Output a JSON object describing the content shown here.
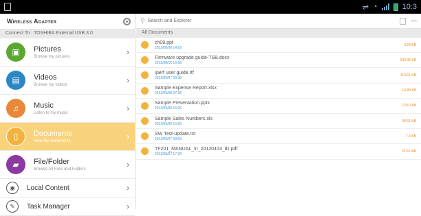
{
  "status": {
    "time": "10:3"
  },
  "sidebar": {
    "title": "Wireless Adapter",
    "connect": "Connect To : TOSHIBA External USB 3.0",
    "items": [
      {
        "label": "Pictures",
        "sub": "Browse my pictures",
        "color": "#5aa832"
      },
      {
        "label": "Videos",
        "sub": "Browse my videos",
        "color": "#2b86c5"
      },
      {
        "label": "Music",
        "sub": "Listen to my music",
        "color": "#e8893a"
      },
      {
        "label": "Documents",
        "sub": "View my documents",
        "color": "#f2b33d"
      },
      {
        "label": "File/Folder",
        "sub": "Browse All Files and Folders",
        "color": "#8a3aa0"
      }
    ],
    "small_items": [
      {
        "label": "Local Content"
      },
      {
        "label": "Task Manager"
      }
    ],
    "chevron": "›"
  },
  "search": {
    "placeholder": "Search and Explorer"
  },
  "section_title": "All Documents",
  "files": [
    {
      "name": "ch08.ppt",
      "date": "2012/08/06 14:16",
      "size": "3.24 KB"
    },
    {
      "name": "Firmware upgrade guide-TSB.docx",
      "date": "2012/08/16 16:58",
      "size": "239.95 KB"
    },
    {
      "name": "Iperf user guide.rtf",
      "date": "2012/09/07 09:38",
      "size": "113.61 KB"
    },
    {
      "name": "Sample Expense Report.xlsx",
      "date": "2012/05/08 07:28",
      "size": "16.89 KB"
    },
    {
      "name": "Sample Presentation.pptx",
      "date": "2012/05/08 16:26",
      "size": "120.0 KB"
    },
    {
      "name": "Sample Sales Numbers.xls",
      "date": "2012/05/08 16:26",
      "size": "38.51 KB"
    },
    {
      "name": "SW Test-update.txt",
      "date": "2012/09/07 09:50",
      "size": "7.4 KB"
    },
    {
      "name": "TF201_MANUAL_in_20120403_ID.pdf",
      "date": "2012/09/07 17:29",
      "size": "15.26 MB"
    }
  ],
  "icons": {
    "pictures": "picture-icon",
    "videos": "film-icon",
    "music": "music-note-icon",
    "documents": "document-icon",
    "file_folder": "folder-icon",
    "local": "local-content-icon",
    "task": "task-manager-icon"
  }
}
